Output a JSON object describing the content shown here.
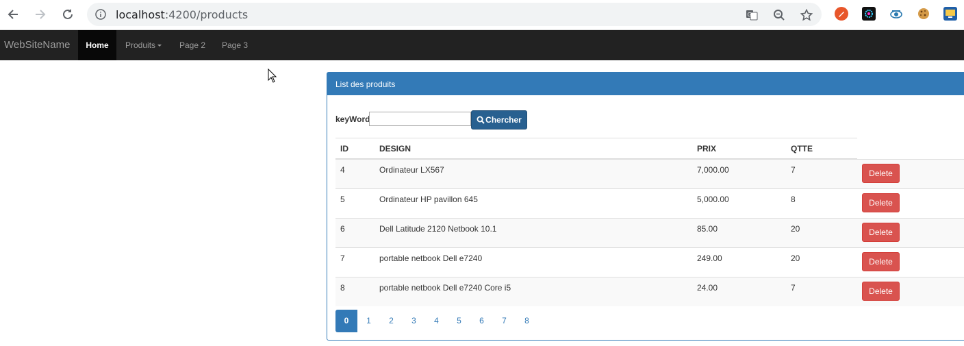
{
  "browser": {
    "url_host": "localhost",
    "url_path": ":4200/products"
  },
  "navbar": {
    "brand": "WebSiteName",
    "links": [
      {
        "label": "Home",
        "active": true
      },
      {
        "label": "Produits",
        "dropdown": true
      },
      {
        "label": "Page 2"
      },
      {
        "label": "Page 3"
      }
    ]
  },
  "panel": {
    "title": "List des produits",
    "search": {
      "label": "keyWord",
      "value": "",
      "button_label": "Chercher"
    },
    "table": {
      "headers": [
        "ID",
        "DESIGN",
        "PRIX",
        "QTTE"
      ],
      "delete_label": "Delete",
      "rows": [
        {
          "id": "4",
          "design": "Ordinateur LX567",
          "prix": "7,000.00",
          "qtte": "7"
        },
        {
          "id": "5",
          "design": "Ordinateur HP pavillon 645",
          "prix": "5,000.00",
          "qtte": "8"
        },
        {
          "id": "6",
          "design": "Dell Latitude 2120 Netbook 10.1",
          "prix": "85.00",
          "qtte": "20"
        },
        {
          "id": "7",
          "design": "portable netbook Dell e7240",
          "prix": "249.00",
          "qtte": "20"
        },
        {
          "id": "8",
          "design": "portable netbook Dell e7240 Core i5",
          "prix": "24.00",
          "qtte": "7"
        }
      ]
    },
    "pagination": {
      "pages": [
        "0",
        "1",
        "2",
        "3",
        "4",
        "5",
        "6",
        "7",
        "8"
      ],
      "current": "0"
    }
  },
  "colors": {
    "primary": "#337ab7",
    "primary_dark": "#286090",
    "danger": "#d9534f",
    "navbar_bg": "#222222"
  }
}
